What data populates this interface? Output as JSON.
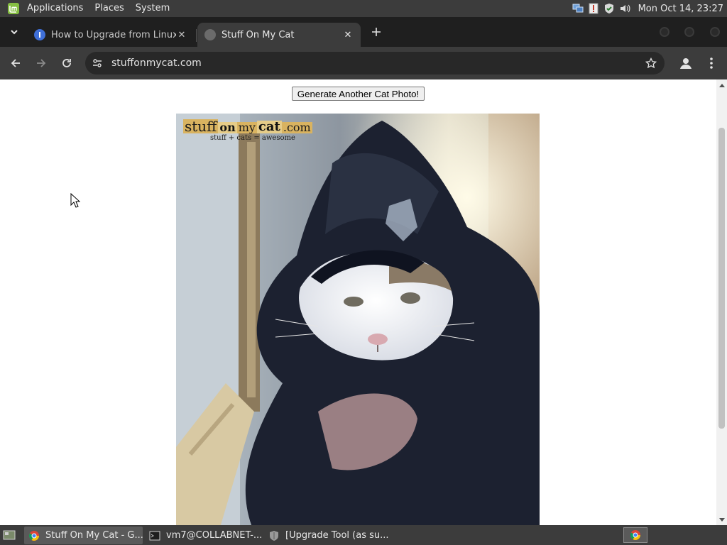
{
  "system_panel": {
    "menus": [
      "Applications",
      "Places",
      "System"
    ],
    "clock": "Mon Oct 14, 23:27"
  },
  "browser": {
    "tabs": [
      {
        "title": "How to Upgrade from Linux",
        "active": false
      },
      {
        "title": "Stuff On My Cat",
        "active": true
      }
    ],
    "url": "stuffonmycat.com"
  },
  "page": {
    "button_label": "Generate Another Cat Photo!",
    "watermark": {
      "word1": "stuff",
      "word2": "on",
      "word3": "my",
      "word4": "cat",
      "word5": ".com",
      "tagline": "stuff + cats = awesome"
    }
  },
  "taskbar": {
    "tasks": [
      {
        "label": "Stuff On My Cat - G...",
        "icon": "chrome-icon",
        "active": true
      },
      {
        "label": "vm7@COLLABNET-...",
        "icon": "terminal-icon",
        "active": false
      },
      {
        "label": "[Upgrade Tool (as su...",
        "icon": "shield-icon",
        "active": false
      }
    ]
  },
  "colors": {
    "panel": "#3c3c3c",
    "tab_strip": "#1f1f1f",
    "omnibox": "#282828",
    "page_bg": "#ffffff"
  }
}
